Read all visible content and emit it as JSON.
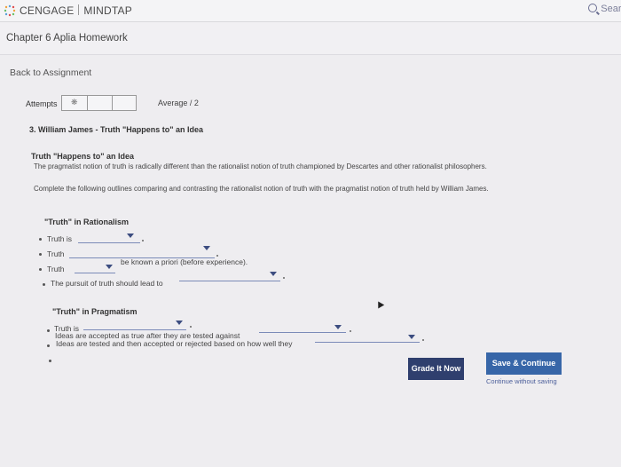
{
  "app": {
    "brand_left": "CENGAGE",
    "brand_right": "MINDTAP",
    "search_label": "Searc"
  },
  "chapter": {
    "title": "Chapter 6 Aplia Homework"
  },
  "nav": {
    "back_label": "Back to Assignment"
  },
  "attempts": {
    "label": "Attempts",
    "average_label": "Average / 2"
  },
  "question": {
    "title": "3. William James - Truth \"Happens to\" an Idea",
    "section_title": "Truth \"Happens to\" an Idea",
    "paragraph_line1": "The pragmatist notion of truth is radically different than the rationalist notion of truth championed by Descartes and other rationalist philosophers.",
    "paragraph_line2": "Complete the following outlines comparing and contrasting the rationalist notion of truth with the pragmatist notion of truth held by William James."
  },
  "rationalism": {
    "heading": "\"Truth\" in Rationalism",
    "items": [
      {
        "prefix": "Truth is",
        "suffix": ""
      },
      {
        "prefix": "Truth",
        "suffix": ""
      },
      {
        "prefix": "Truth",
        "suffix": "be known a priori (before experience)."
      },
      {
        "prefix": "The pursuit of truth should lead to",
        "suffix": ""
      }
    ]
  },
  "pragmatism": {
    "heading": "\"Truth\" in Pragmatism",
    "items": [
      {
        "prefix": "Truth is",
        "suffix": ""
      },
      {
        "prefix": "Ideas are accepted as true after they are tested against",
        "suffix": ""
      },
      {
        "prefix": "Ideas are tested and then accepted or rejected based on how well they",
        "suffix": ""
      }
    ]
  },
  "actions": {
    "grade_label": "Grade It Now",
    "save_label": "Save & Continue",
    "continue_label": "Continue without saving"
  },
  "colors": {
    "grade_button": "#2f3f6e",
    "save_button": "#3766a8",
    "dropdown_line": "#7b8bb8"
  }
}
